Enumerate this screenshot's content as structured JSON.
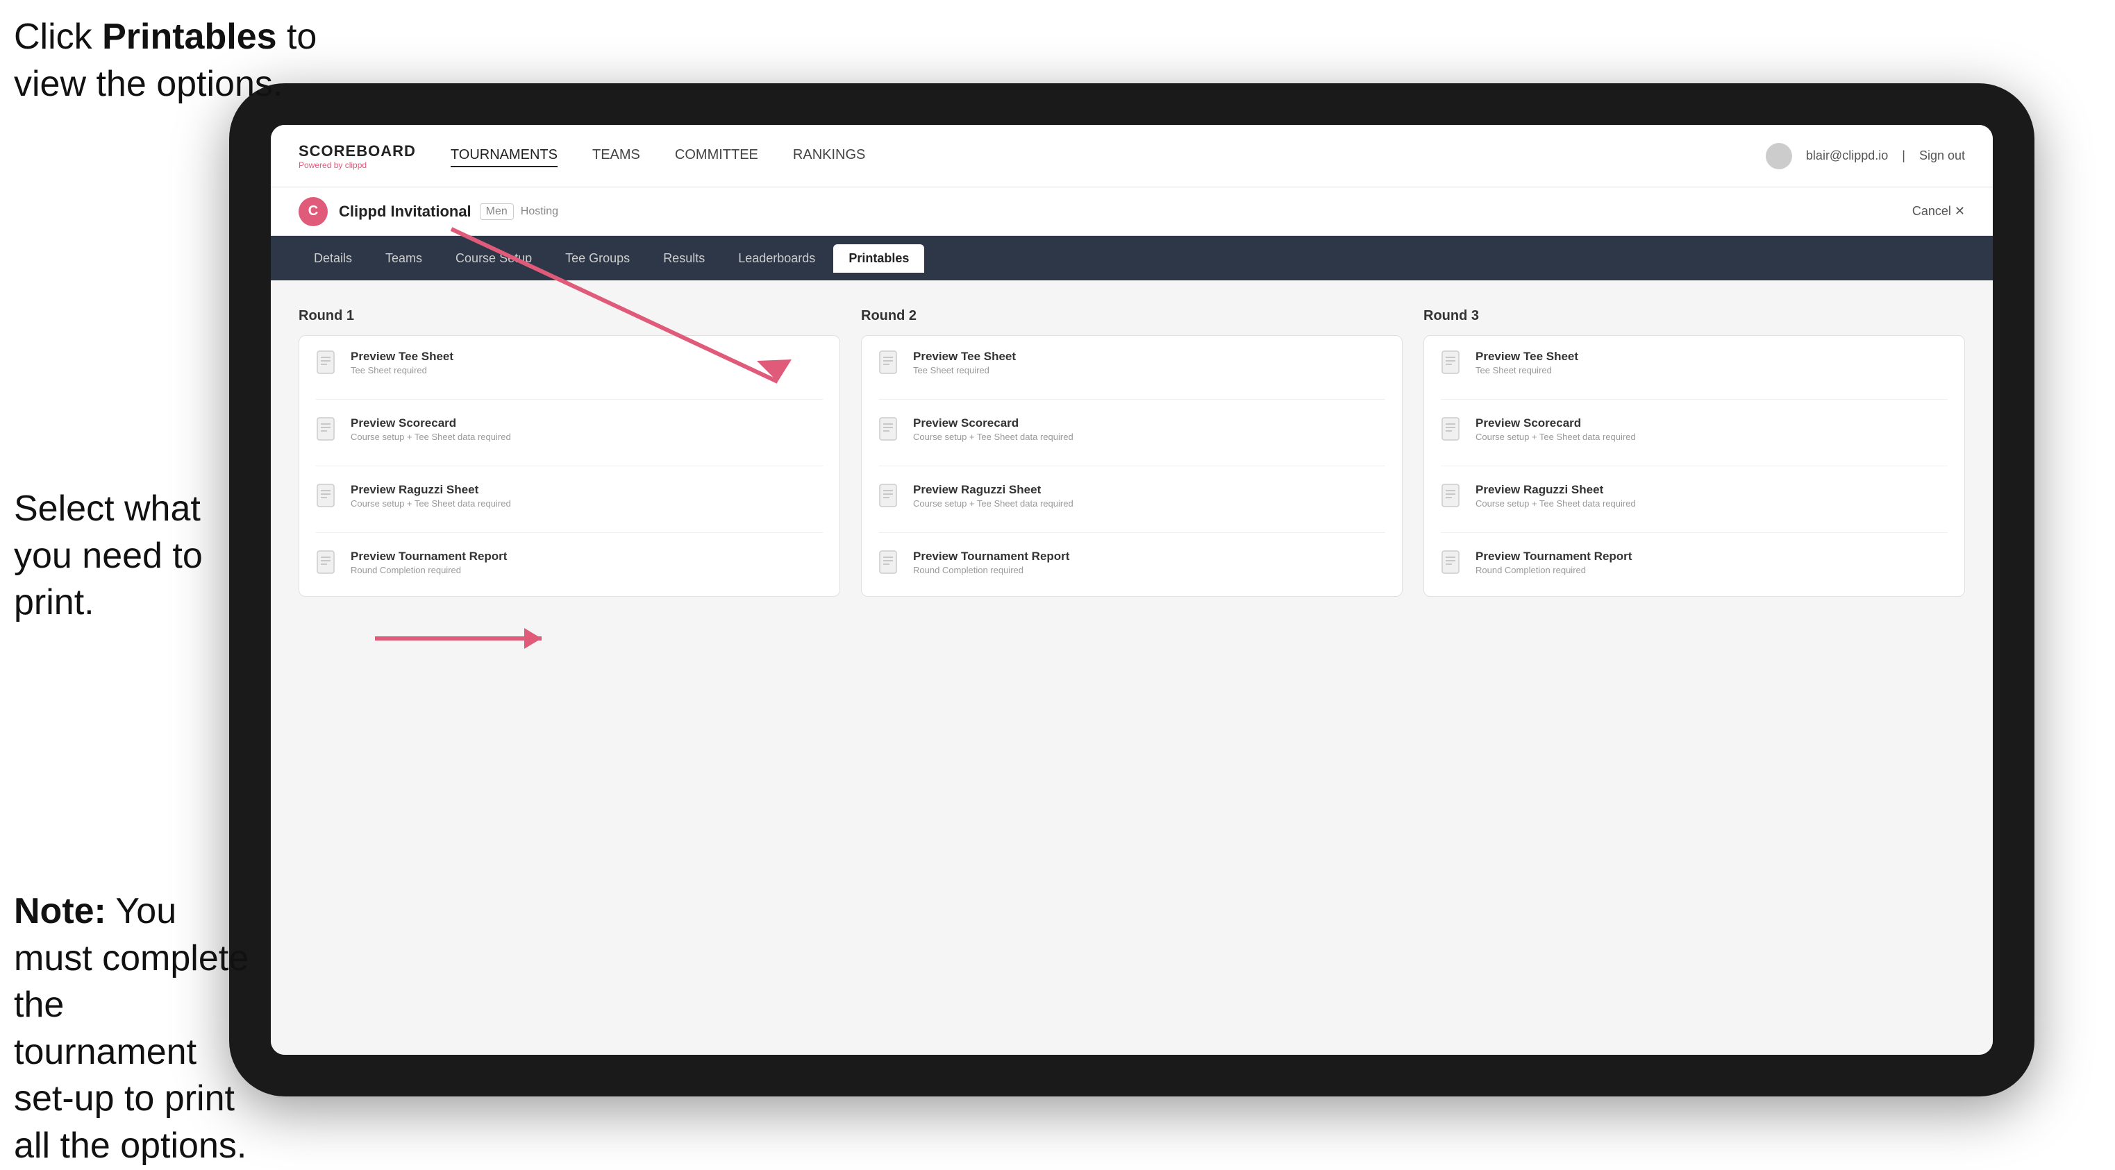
{
  "annotations": {
    "top": {
      "line1": "Click ",
      "bold": "Printables",
      "line2": " to",
      "line3": "view the options."
    },
    "middle": {
      "text": "Select what you need to print."
    },
    "bottom": {
      "bold": "Note:",
      "text": " You must complete the tournament set-up to print all the options."
    }
  },
  "topnav": {
    "logo": "SCOREBOARD",
    "logo_sub": "Powered by clippd",
    "links": [
      "TOURNAMENTS",
      "TEAMS",
      "COMMITTEE",
      "RANKINGS"
    ],
    "active_link": "TOURNAMENTS",
    "user_email": "blair@clippd.io",
    "sign_out": "Sign out"
  },
  "tournament": {
    "name": "Clippd Invitational",
    "badge": "Men",
    "status": "Hosting",
    "cancel": "Cancel ✕"
  },
  "subnav": {
    "tabs": [
      "Details",
      "Teams",
      "Course Setup",
      "Tee Groups",
      "Results",
      "Leaderboards",
      "Printables"
    ],
    "active_tab": "Printables"
  },
  "rounds": [
    {
      "title": "Round 1",
      "items": [
        {
          "label": "Preview Tee Sheet",
          "sublabel": "Tee Sheet required"
        },
        {
          "label": "Preview Scorecard",
          "sublabel": "Course setup + Tee Sheet data required"
        },
        {
          "label": "Preview Raguzzi Sheet",
          "sublabel": "Course setup + Tee Sheet data required"
        },
        {
          "label": "Preview Tournament Report",
          "sublabel": "Round Completion required"
        }
      ]
    },
    {
      "title": "Round 2",
      "items": [
        {
          "label": "Preview Tee Sheet",
          "sublabel": "Tee Sheet required"
        },
        {
          "label": "Preview Scorecard",
          "sublabel": "Course setup + Tee Sheet data required"
        },
        {
          "label": "Preview Raguzzi Sheet",
          "sublabel": "Course setup + Tee Sheet data required"
        },
        {
          "label": "Preview Tournament Report",
          "sublabel": "Round Completion required"
        }
      ]
    },
    {
      "title": "Round 3",
      "items": [
        {
          "label": "Preview Tee Sheet",
          "sublabel": "Tee Sheet required"
        },
        {
          "label": "Preview Scorecard",
          "sublabel": "Course setup + Tee Sheet data required"
        },
        {
          "label": "Preview Raguzzi Sheet",
          "sublabel": "Course setup + Tee Sheet data required"
        },
        {
          "label": "Preview Tournament Report",
          "sublabel": "Round Completion required"
        }
      ]
    }
  ]
}
